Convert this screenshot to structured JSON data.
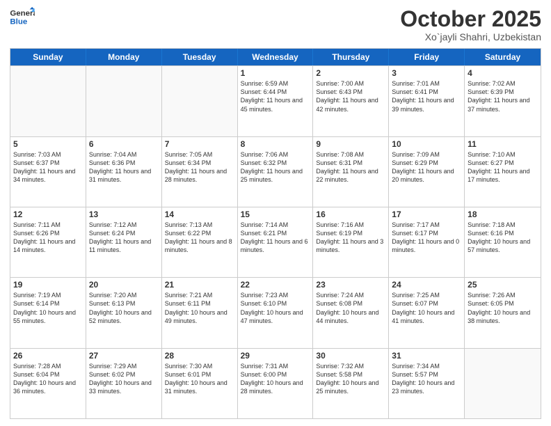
{
  "logo": {
    "line1": "General",
    "line2": "Blue"
  },
  "header": {
    "month": "October 2025",
    "location": "Xo`jayli Shahri, Uzbekistan"
  },
  "days": [
    "Sunday",
    "Monday",
    "Tuesday",
    "Wednesday",
    "Thursday",
    "Friday",
    "Saturday"
  ],
  "weeks": [
    [
      {
        "day": "",
        "empty": true
      },
      {
        "day": "",
        "empty": true
      },
      {
        "day": "",
        "empty": true
      },
      {
        "day": "1",
        "sunrise": "6:59 AM",
        "sunset": "6:44 PM",
        "daylight": "11 hours and 45 minutes."
      },
      {
        "day": "2",
        "sunrise": "7:00 AM",
        "sunset": "6:43 PM",
        "daylight": "11 hours and 42 minutes."
      },
      {
        "day": "3",
        "sunrise": "7:01 AM",
        "sunset": "6:41 PM",
        "daylight": "11 hours and 39 minutes."
      },
      {
        "day": "4",
        "sunrise": "7:02 AM",
        "sunset": "6:39 PM",
        "daylight": "11 hours and 37 minutes."
      }
    ],
    [
      {
        "day": "5",
        "sunrise": "7:03 AM",
        "sunset": "6:37 PM",
        "daylight": "11 hours and 34 minutes."
      },
      {
        "day": "6",
        "sunrise": "7:04 AM",
        "sunset": "6:36 PM",
        "daylight": "11 hours and 31 minutes."
      },
      {
        "day": "7",
        "sunrise": "7:05 AM",
        "sunset": "6:34 PM",
        "daylight": "11 hours and 28 minutes."
      },
      {
        "day": "8",
        "sunrise": "7:06 AM",
        "sunset": "6:32 PM",
        "daylight": "11 hours and 25 minutes."
      },
      {
        "day": "9",
        "sunrise": "7:08 AM",
        "sunset": "6:31 PM",
        "daylight": "11 hours and 22 minutes."
      },
      {
        "day": "10",
        "sunrise": "7:09 AM",
        "sunset": "6:29 PM",
        "daylight": "11 hours and 20 minutes."
      },
      {
        "day": "11",
        "sunrise": "7:10 AM",
        "sunset": "6:27 PM",
        "daylight": "11 hours and 17 minutes."
      }
    ],
    [
      {
        "day": "12",
        "sunrise": "7:11 AM",
        "sunset": "6:26 PM",
        "daylight": "11 hours and 14 minutes."
      },
      {
        "day": "13",
        "sunrise": "7:12 AM",
        "sunset": "6:24 PM",
        "daylight": "11 hours and 11 minutes."
      },
      {
        "day": "14",
        "sunrise": "7:13 AM",
        "sunset": "6:22 PM",
        "daylight": "11 hours and 8 minutes."
      },
      {
        "day": "15",
        "sunrise": "7:14 AM",
        "sunset": "6:21 PM",
        "daylight": "11 hours and 6 minutes."
      },
      {
        "day": "16",
        "sunrise": "7:16 AM",
        "sunset": "6:19 PM",
        "daylight": "11 hours and 3 minutes."
      },
      {
        "day": "17",
        "sunrise": "7:17 AM",
        "sunset": "6:17 PM",
        "daylight": "11 hours and 0 minutes."
      },
      {
        "day": "18",
        "sunrise": "7:18 AM",
        "sunset": "6:16 PM",
        "daylight": "10 hours and 57 minutes."
      }
    ],
    [
      {
        "day": "19",
        "sunrise": "7:19 AM",
        "sunset": "6:14 PM",
        "daylight": "10 hours and 55 minutes."
      },
      {
        "day": "20",
        "sunrise": "7:20 AM",
        "sunset": "6:13 PM",
        "daylight": "10 hours and 52 minutes."
      },
      {
        "day": "21",
        "sunrise": "7:21 AM",
        "sunset": "6:11 PM",
        "daylight": "10 hours and 49 minutes."
      },
      {
        "day": "22",
        "sunrise": "7:23 AM",
        "sunset": "6:10 PM",
        "daylight": "10 hours and 47 minutes."
      },
      {
        "day": "23",
        "sunrise": "7:24 AM",
        "sunset": "6:08 PM",
        "daylight": "10 hours and 44 minutes."
      },
      {
        "day": "24",
        "sunrise": "7:25 AM",
        "sunset": "6:07 PM",
        "daylight": "10 hours and 41 minutes."
      },
      {
        "day": "25",
        "sunrise": "7:26 AM",
        "sunset": "6:05 PM",
        "daylight": "10 hours and 38 minutes."
      }
    ],
    [
      {
        "day": "26",
        "sunrise": "7:28 AM",
        "sunset": "6:04 PM",
        "daylight": "10 hours and 36 minutes."
      },
      {
        "day": "27",
        "sunrise": "7:29 AM",
        "sunset": "6:02 PM",
        "daylight": "10 hours and 33 minutes."
      },
      {
        "day": "28",
        "sunrise": "7:30 AM",
        "sunset": "6:01 PM",
        "daylight": "10 hours and 31 minutes."
      },
      {
        "day": "29",
        "sunrise": "7:31 AM",
        "sunset": "6:00 PM",
        "daylight": "10 hours and 28 minutes."
      },
      {
        "day": "30",
        "sunrise": "7:32 AM",
        "sunset": "5:58 PM",
        "daylight": "10 hours and 25 minutes."
      },
      {
        "day": "31",
        "sunrise": "7:34 AM",
        "sunset": "5:57 PM",
        "daylight": "10 hours and 23 minutes."
      },
      {
        "day": "",
        "empty": true
      }
    ]
  ]
}
